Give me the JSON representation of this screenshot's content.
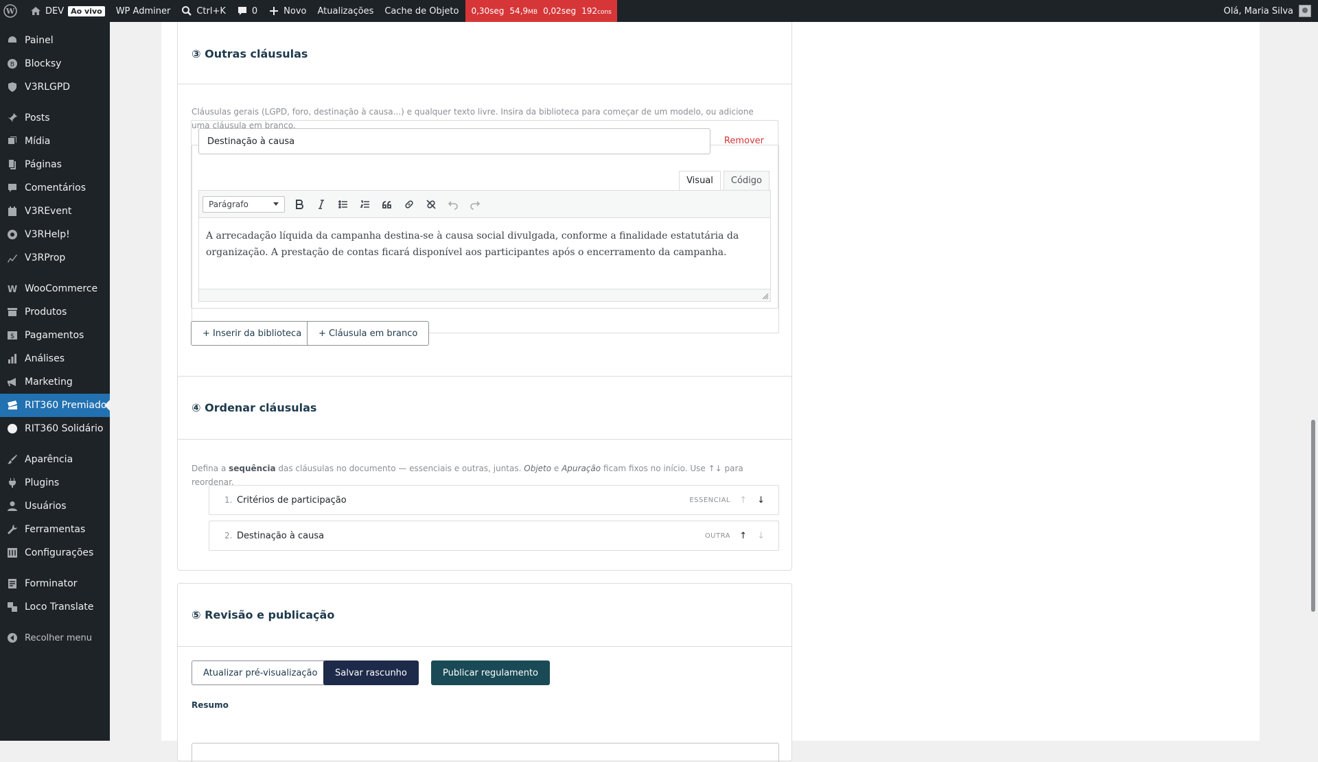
{
  "adminbar": {
    "site": "DEV",
    "live": "Ao vivo",
    "adminer": "WP Adminer",
    "search": "Ctrl+K",
    "comments": "0",
    "new": "Novo",
    "updates": "Atualizações",
    "cache": "Cache de Objeto",
    "perf": {
      "time1": "0,30seg",
      "mem": "54,9",
      "mem_unit": "MB",
      "time2": "0,02seg",
      "queries": "192",
      "queries_unit": "cons"
    },
    "greeting": "Olá, Maria Silva"
  },
  "sidebar": {
    "items": [
      {
        "label": "Painel",
        "icon": "dashboard-icon"
      },
      {
        "label": "Blocksy",
        "icon": "blocksy-icon"
      },
      {
        "label": "V3RLGPD",
        "icon": "shield-icon"
      },
      {
        "label": "Posts",
        "icon": "pin-icon"
      },
      {
        "label": "Mídia",
        "icon": "media-icon"
      },
      {
        "label": "Páginas",
        "icon": "pages-icon"
      },
      {
        "label": "Comentários",
        "icon": "comment-icon"
      },
      {
        "label": "V3REvent",
        "icon": "calendar-icon"
      },
      {
        "label": "V3RHelp!",
        "icon": "lifebuoy-icon"
      },
      {
        "label": "V3RProp",
        "icon": "chart-line-icon"
      },
      {
        "label": "WooCommerce",
        "icon": "woo-icon"
      },
      {
        "label": "Produtos",
        "icon": "archive-icon"
      },
      {
        "label": "Pagamentos",
        "icon": "dollar-icon"
      },
      {
        "label": "Análises",
        "icon": "bar-chart-icon"
      },
      {
        "label": "Marketing",
        "icon": "megaphone-icon"
      },
      {
        "label": "RIT360 Premiado",
        "icon": "ticket-icon"
      },
      {
        "label": "RIT360 Solidário",
        "icon": "circle-icon"
      },
      {
        "label": "Aparência",
        "icon": "brush-icon"
      },
      {
        "label": "Plugins",
        "icon": "plug-icon"
      },
      {
        "label": "Usuários",
        "icon": "user-icon"
      },
      {
        "label": "Ferramentas",
        "icon": "wrench-icon"
      },
      {
        "label": "Configurações",
        "icon": "settings-icon"
      },
      {
        "label": "Forminator",
        "icon": "form-icon"
      },
      {
        "label": "Loco Translate",
        "icon": "translate-icon"
      }
    ],
    "collapse": "Recolher menu"
  },
  "section3": {
    "title": "③ Outras cláusulas",
    "description": "Cláusulas gerais (LGPD, foro, destinação à causa...) e qualquer texto livre. Insira da biblioteca para começar de um modelo, ou adicione uma cláusula em branco.",
    "clause": {
      "title_value": "Destinação à causa",
      "remove": "Remover",
      "tab_visual": "Visual",
      "tab_code": "Código",
      "format": "Parágrafo",
      "content": "A arrecadação líquida da campanha destina-se à causa social divulgada, conforme a finalidade estatutária da organização. A prestação de contas ficará disponível aos participantes após o encerramento da campanha."
    },
    "btn_library": "+ Inserir da biblioteca",
    "btn_blank": "+ Cláusula em branco"
  },
  "section4": {
    "title": "④ Ordenar cláusulas",
    "desc_pre": "Defina a ",
    "desc_bold": "sequência",
    "desc_mid": " das cláusulas no documento — essenciais e outras, juntas. ",
    "desc_i1": "Objeto",
    "desc_e": " e ",
    "desc_i2": "Apuração",
    "desc_post": " ficam fixos no início. Use ↑↓ para reordenar.",
    "rows": [
      {
        "num": "1.",
        "label": "Critérios de participação",
        "tag": "ESSENCIAL"
      },
      {
        "num": "2.",
        "label": "Destinação à causa",
        "tag": "OUTRA"
      }
    ],
    "arrow_up": "↑",
    "arrow_down": "↓"
  },
  "section5": {
    "title": "⑤ Revisão e publicação",
    "btn_preview": "Atualizar pré-visualização",
    "btn_draft": "Salvar rascunho",
    "btn_publish": "Publicar regulamento",
    "summary_label": "Resumo"
  }
}
